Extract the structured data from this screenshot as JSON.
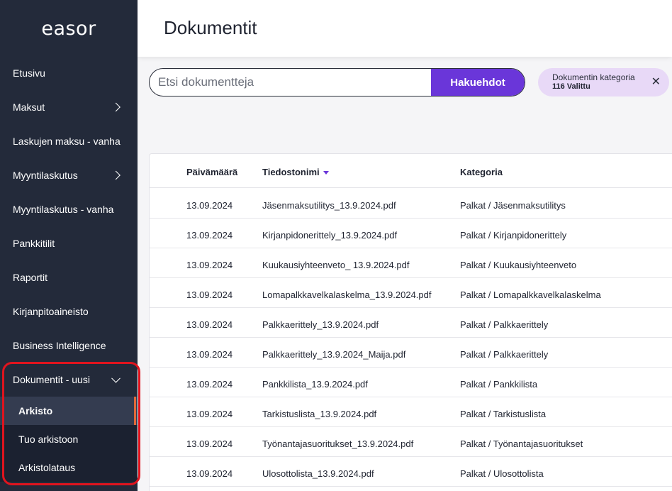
{
  "app": {
    "logo": "easor"
  },
  "header": {
    "title": "Dokumentit"
  },
  "sidebar": {
    "items": [
      {
        "label": "Etusivu"
      },
      {
        "label": "Maksut"
      },
      {
        "label": "Laskujen maksu - vanha"
      },
      {
        "label": "Myyntilaskutus"
      },
      {
        "label": "Myyntilaskutus - vanha"
      },
      {
        "label": "Pankkitilit"
      },
      {
        "label": "Raportit"
      },
      {
        "label": "Kirjanpitoaineisto"
      },
      {
        "label": "Business Intelligence"
      },
      {
        "label": "Dokumentit - uusi"
      }
    ],
    "subitems": [
      {
        "label": "Arkisto"
      },
      {
        "label": "Tuo arkistoon"
      },
      {
        "label": "Arkistolataus"
      }
    ]
  },
  "search": {
    "placeholder": "Etsi dokumentteja",
    "button_label": "Hakuehdot"
  },
  "filter_chip": {
    "label": "Dokumentin kategoria",
    "value": "116 Valittu",
    "close": "✕"
  },
  "table": {
    "columns": [
      "Päivämäärä",
      "Tiedostonimi",
      "Kategoria"
    ],
    "rows": [
      [
        "13.09.2024",
        "Jäsenmaksutilitys_13.9.2024.pdf",
        "Palkat / Jäsenmaksutilitys"
      ],
      [
        "13.09.2024",
        "Kirjanpidonerittely_13.9.2024.pdf",
        "Palkat / Kirjanpidonerittely"
      ],
      [
        "13.09.2024",
        "Kuukausiyhteenveto_ 13.9.2024.pdf",
        "Palkat / Kuukausiyhteenveto"
      ],
      [
        "13.09.2024",
        "Lomapalkkavelkalaskelma_13.9.2024.pdf",
        "Palkat / Lomapalkkavelkalaskelma"
      ],
      [
        "13.09.2024",
        "Palkkaerittely_13.9.2024.pdf",
        "Palkat / Palkkaerittely"
      ],
      [
        "13.09.2024",
        "Palkkaerittely_13.9.2024_Maija.pdf",
        "Palkat / Palkkaerittely"
      ],
      [
        "13.09.2024",
        "Pankkilista_13.9.2024.pdf",
        "Palkat / Pankkilista"
      ],
      [
        "13.09.2024",
        "Tarkistuslista_13.9.2024.pdf",
        "Palkat / Tarkistuslista"
      ],
      [
        "13.09.2024",
        "Työnantajasuoritukset_13.9.2024.pdf",
        "Palkat / Työnantajasuoritukset"
      ],
      [
        "13.09.2024",
        "Ulosottolista_13.9.2024.pdf",
        "Palkat / Ulosottolista"
      ]
    ]
  }
}
